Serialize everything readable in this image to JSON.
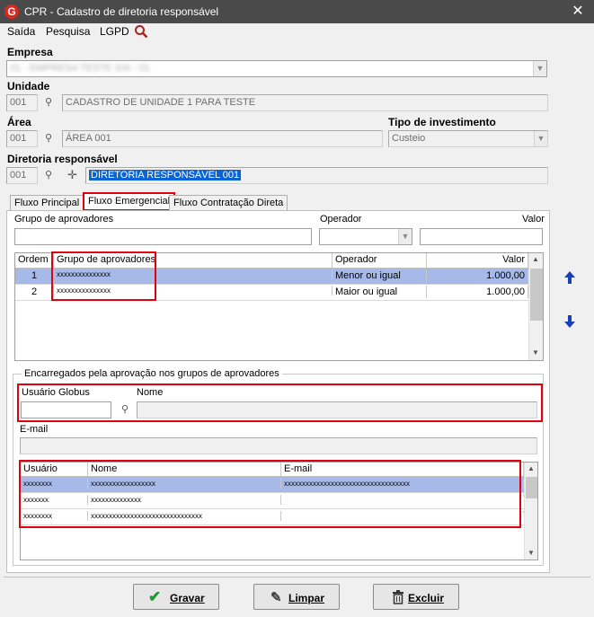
{
  "window": {
    "title": "CPR - Cadastro de diretoria responsável",
    "app_icon": "G"
  },
  "menu": {
    "saida": "Saída",
    "pesquisa": "Pesquisa",
    "lgpd": "LGPD"
  },
  "empresa": {
    "label": "Empresa",
    "value": "01 - EMPRESA TESTE S/A - 01"
  },
  "unidade": {
    "label": "Unidade",
    "code": "001",
    "desc": "CADASTRO DE UNIDADE 1 PARA TESTE"
  },
  "area": {
    "label": "Área",
    "code": "001",
    "desc": "ÁREA 001"
  },
  "tipo_investimento": {
    "label": "Tipo de investimento",
    "value": "Custeio"
  },
  "diretoria": {
    "label": "Diretoria responsável",
    "code": "001",
    "desc": "DIRETORIA RESPONSÁVEL 001"
  },
  "tabs": [
    "Fluxo Principal",
    "Fluxo Emergencial",
    "Fluxo Contratação Direta"
  ],
  "filters": {
    "grupo_label": "Grupo de aprovadores",
    "operador_label": "Operador",
    "valor_label": "Valor"
  },
  "grid1": {
    "headers": [
      "Ordem",
      "Grupo de aprovadores",
      "Operador",
      "Valor"
    ],
    "rows": [
      {
        "ordem": "1",
        "grupo": "xxxxxxxxxxxxxxx",
        "operador": "Menor ou igual",
        "valor": "1.000,00"
      },
      {
        "ordem": "2",
        "grupo": "xxxxxxxxxxxxxxx",
        "operador": "Maior ou igual",
        "valor": "1.000,00"
      }
    ]
  },
  "encarregados": {
    "legend": "Encarregados pela aprovação nos grupos de aprovadores",
    "usuario_label": "Usuário Globus",
    "nome_label": "Nome",
    "email_label": "E-mail"
  },
  "grid2": {
    "headers": [
      "Usuário",
      "Nome",
      "E-mail"
    ],
    "rows": [
      {
        "usuario": "xxxxxxxx",
        "nome": "xxxxxxxxxxxxxxxxxx",
        "email": "xxxxxxxxxxxxxxxxxxxxxxxxxxxxxxxxxxx"
      },
      {
        "usuario": "xxxxxxx",
        "nome": "xxxxxxxxxxxxxx",
        "email": ""
      },
      {
        "usuario": "xxxxxxxx",
        "nome": "xxxxxxxxxxxxxxxxxxxxxxxxxxxxxxx",
        "email": ""
      }
    ]
  },
  "buttons": {
    "gravar": "Gravar",
    "limpar": "Limpar",
    "excluir": "Excluir"
  },
  "colors": {
    "titlebar": "#4a4a4a",
    "highlight": "#a6b9e8",
    "red_annotation": "#e1000f",
    "arrow_blue": "#1a3fb8"
  }
}
